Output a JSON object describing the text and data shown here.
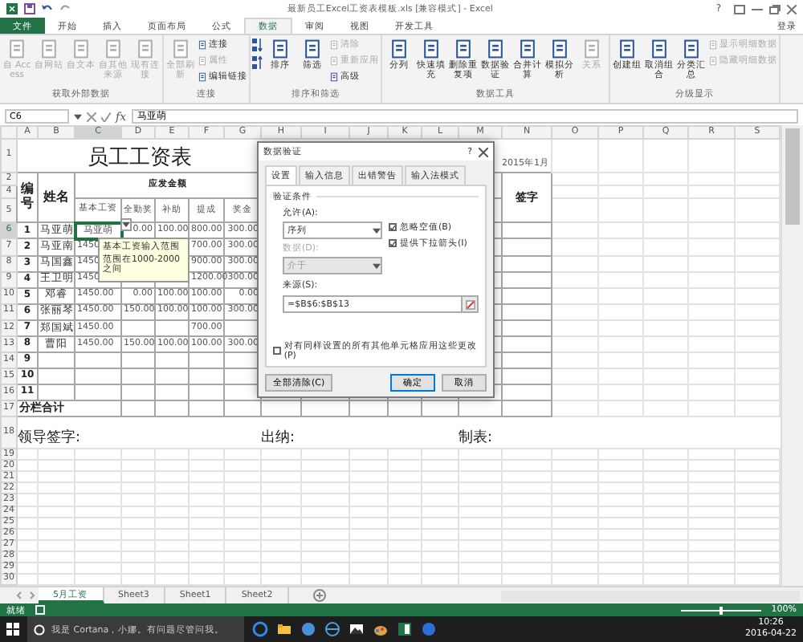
{
  "window": {
    "title": "最新员工Excel工资表模板.xls [兼容模式] - Excel",
    "help": "?"
  },
  "ribbon_tabs": [
    {
      "label": "文件",
      "kind": "file",
      "selected": false
    },
    {
      "label": "开始",
      "kind": "tab",
      "selected": false
    },
    {
      "label": "插入",
      "kind": "tab",
      "selected": false
    },
    {
      "label": "页面布局",
      "kind": "tab",
      "selected": false
    },
    {
      "label": "公式",
      "kind": "tab",
      "selected": false
    },
    {
      "label": "数据",
      "kind": "tab",
      "selected": true
    },
    {
      "label": "审阅",
      "kind": "tab",
      "selected": false
    },
    {
      "label": "视图",
      "kind": "tab",
      "selected": false
    },
    {
      "label": "开发工具",
      "kind": "tab",
      "selected": false
    }
  ],
  "account": "登录",
  "ribbon_groups": [
    {
      "label": "获取外部数据",
      "items": [
        {
          "label": "自 Access",
          "kind": "large",
          "disabled": true
        },
        {
          "label": "自网站",
          "kind": "large",
          "disabled": true
        },
        {
          "label": "自文本",
          "kind": "large",
          "disabled": true
        },
        {
          "label": "自其他来源",
          "kind": "large",
          "disabled": true
        },
        {
          "label": "现有连接",
          "kind": "large",
          "disabled": true
        }
      ]
    },
    {
      "label": "连接",
      "items": [
        {
          "label": "全部刷新",
          "kind": "large",
          "disabled": true
        },
        {
          "label": "连接",
          "kind": "small",
          "disabled": false
        },
        {
          "label": "属性",
          "kind": "small",
          "disabled": true
        },
        {
          "label": "编辑链接",
          "kind": "small",
          "disabled": false
        }
      ]
    },
    {
      "label": "排序和筛选",
      "items": [
        {
          "kind": "sort-icons",
          "disabled": false
        },
        {
          "label": "排序",
          "kind": "large",
          "disabled": false
        },
        {
          "label": "筛选",
          "kind": "large",
          "disabled": false
        },
        {
          "label": "清除",
          "kind": "small",
          "disabled": true
        },
        {
          "label": "重新应用",
          "kind": "small",
          "disabled": true
        },
        {
          "label": "高级",
          "kind": "small",
          "disabled": false
        }
      ]
    },
    {
      "label": "数据工具",
      "items": [
        {
          "label": "分列",
          "kind": "large",
          "disabled": false
        },
        {
          "label": "快速填充",
          "kind": "large",
          "disabled": false
        },
        {
          "label": "删除重复项",
          "kind": "large",
          "disabled": false
        },
        {
          "label": "数据验证",
          "kind": "large",
          "disabled": false
        },
        {
          "label": "合并计算",
          "kind": "large",
          "disabled": false
        },
        {
          "label": "模拟分析",
          "kind": "large",
          "disabled": false
        },
        {
          "label": "关系",
          "kind": "large",
          "disabled": true
        }
      ]
    },
    {
      "label": "分级显示",
      "items": [
        {
          "label": "创建组",
          "kind": "large",
          "disabled": false
        },
        {
          "label": "取消组合",
          "kind": "large",
          "disabled": false
        },
        {
          "label": "分类汇总",
          "kind": "large",
          "disabled": false
        },
        {
          "label": "显示明细数据",
          "kind": "small",
          "disabled": true
        },
        {
          "label": "隐藏明细数据",
          "kind": "small",
          "disabled": true
        }
      ]
    }
  ],
  "formula_bar": {
    "name_box": "C6",
    "function_label": "fx",
    "value": "马亚萌"
  },
  "column_headers": [
    {
      "label": "A",
      "selected": false
    },
    {
      "label": "B",
      "selected": false
    },
    {
      "label": "C",
      "selected": true
    },
    {
      "label": "D",
      "selected": false
    },
    {
      "label": "E",
      "selected": false
    },
    {
      "label": "F",
      "selected": false
    },
    {
      "label": "G",
      "selected": false
    },
    {
      "label": "H",
      "selected": false
    },
    {
      "label": "I",
      "selected": false
    },
    {
      "label": "J",
      "selected": false
    },
    {
      "label": "K",
      "selected": false
    },
    {
      "label": "L",
      "selected": false
    },
    {
      "label": "M",
      "selected": false
    },
    {
      "label": "N",
      "selected": false
    },
    {
      "label": "O",
      "selected": false
    },
    {
      "label": "P",
      "selected": false
    },
    {
      "label": "Q",
      "selected": false
    },
    {
      "label": "R",
      "selected": false
    },
    {
      "label": "S",
      "selected": false
    }
  ],
  "row_numbers": [
    {
      "label": "1",
      "selected": false
    },
    {
      "label": "2",
      "selected": false
    },
    {
      "label": "4",
      "selected": false
    },
    {
      "label": "5",
      "selected": false
    },
    {
      "label": "6",
      "selected": true
    },
    {
      "label": "7",
      "selected": false
    },
    {
      "label": "8",
      "selected": false
    },
    {
      "label": "9",
      "selected": false
    },
    {
      "label": "10",
      "selected": false
    },
    {
      "label": "11",
      "selected": false
    },
    {
      "label": "12",
      "selected": false
    },
    {
      "label": "13",
      "selected": false
    },
    {
      "label": "14",
      "selected": false
    },
    {
      "label": "15",
      "selected": false
    },
    {
      "label": "16",
      "selected": false
    },
    {
      "label": "17",
      "selected": false
    },
    {
      "label": "18",
      "selected": false
    },
    {
      "label": "19",
      "selected": false
    },
    {
      "label": "20",
      "selected": false
    },
    {
      "label": "21",
      "selected": false
    },
    {
      "label": "22",
      "selected": false
    },
    {
      "label": "23",
      "selected": false
    },
    {
      "label": "24",
      "selected": false
    },
    {
      "label": "25",
      "selected": false
    },
    {
      "label": "26",
      "selected": false
    },
    {
      "label": "27",
      "selected": false
    },
    {
      "label": "28",
      "selected": false
    },
    {
      "label": "29",
      "selected": false
    },
    {
      "label": "30",
      "selected": false
    }
  ],
  "sheet": {
    "title": "员工工资表",
    "date": "2015年1月",
    "headers": {
      "number": "编号",
      "name": "姓名",
      "group": "应发金额",
      "sign": "签字",
      "columns": [
        "基本工资",
        "全勤奖",
        "补助",
        "提成",
        "奖金"
      ]
    },
    "rows": [
      {
        "number": "1",
        "name": "马亚萌",
        "cells": [
          "马亚萌",
          "0.00",
          "100.00",
          "800.00",
          "300.00"
        ]
      },
      {
        "number": "2",
        "name": "马亚南",
        "cells": [
          "1450",
          "",
          "",
          "700.00",
          "300.00"
        ]
      },
      {
        "number": "3",
        "name": "马国鑫",
        "cells": [
          "1450",
          "",
          "",
          "900.00",
          "300.00"
        ]
      },
      {
        "number": "4",
        "name": "王卫明",
        "cells": [
          "1450",
          "",
          "",
          "1200.00",
          "300.00"
        ]
      },
      {
        "number": "5",
        "name": "邓睿",
        "cells": [
          "1450.00",
          "0.00",
          "100.00",
          "100.00",
          "0.00"
        ]
      },
      {
        "number": "6",
        "name": "张丽琴",
        "cells": [
          "1450.00",
          "150.00",
          "100.00",
          "100.00",
          "300.00"
        ]
      },
      {
        "number": "7",
        "name": "郑国斌",
        "cells": [
          "1450.00",
          "",
          "",
          "700.00",
          ""
        ]
      },
      {
        "number": "8",
        "name": "曹阳",
        "cells": [
          "1450.00",
          "150.00",
          "100.00",
          "100.00",
          "300.00"
        ]
      },
      {
        "number": "9",
        "cells": [
          "",
          "",
          "",
          "",
          ""
        ]
      },
      {
        "number": "10",
        "cells": [
          "",
          "",
          "",
          "",
          ""
        ]
      },
      {
        "number": "11",
        "cells": [
          "",
          "",
          "",
          "",
          ""
        ]
      }
    ],
    "subtotal": "分栏合计",
    "signatures": [
      "领导签字:",
      "出纳:",
      "制表:"
    ]
  },
  "tooltip": {
    "title": "基本工资输入范围",
    "text": "范围在1000-2000之间"
  },
  "dialog": {
    "title": "数据验证",
    "help": "?",
    "tabs": [
      {
        "label": "设置",
        "selected": true
      },
      {
        "label": "输入信息",
        "selected": false
      },
      {
        "label": "出错警告",
        "selected": false
      },
      {
        "label": "输入法模式",
        "selected": false
      }
    ],
    "section": "验证条件",
    "allow_label": "允许(A):",
    "allow_value": "序列",
    "data_label": "数据(D):",
    "data_value": "介于",
    "data_disabled": true,
    "checkboxes": [
      {
        "label": "忽略空值(B)",
        "checked": true
      },
      {
        "label": "提供下拉箭头(I)",
        "checked": true
      }
    ],
    "source_label": "来源(S):",
    "source_value": "=$B$6:$B$13",
    "apply_all": {
      "label": "对有同样设置的所有其他单元格应用这些更改(P)",
      "checked": false
    },
    "buttons": [
      {
        "label": "全部清除(C)",
        "kind": "secondary"
      },
      {
        "label": "确定",
        "kind": "primary"
      },
      {
        "label": "取消",
        "kind": "secondary"
      }
    ]
  },
  "sheet_tabs": [
    {
      "label": "5月工资",
      "selected": true
    },
    {
      "label": "Sheet3",
      "selected": false
    },
    {
      "label": "Sheet1",
      "selected": false
    },
    {
      "label": "Sheet2",
      "selected": false
    }
  ],
  "status_bar": {
    "mode": "就绪",
    "zoom": "100%",
    "zoom_slider": {
      "level": 0.5
    }
  },
  "taskbar": {
    "search_placeholder": "我是 Cortana，小娜。有问题尽管问我。",
    "time": "10:26",
    "date": "2016-04-22"
  }
}
